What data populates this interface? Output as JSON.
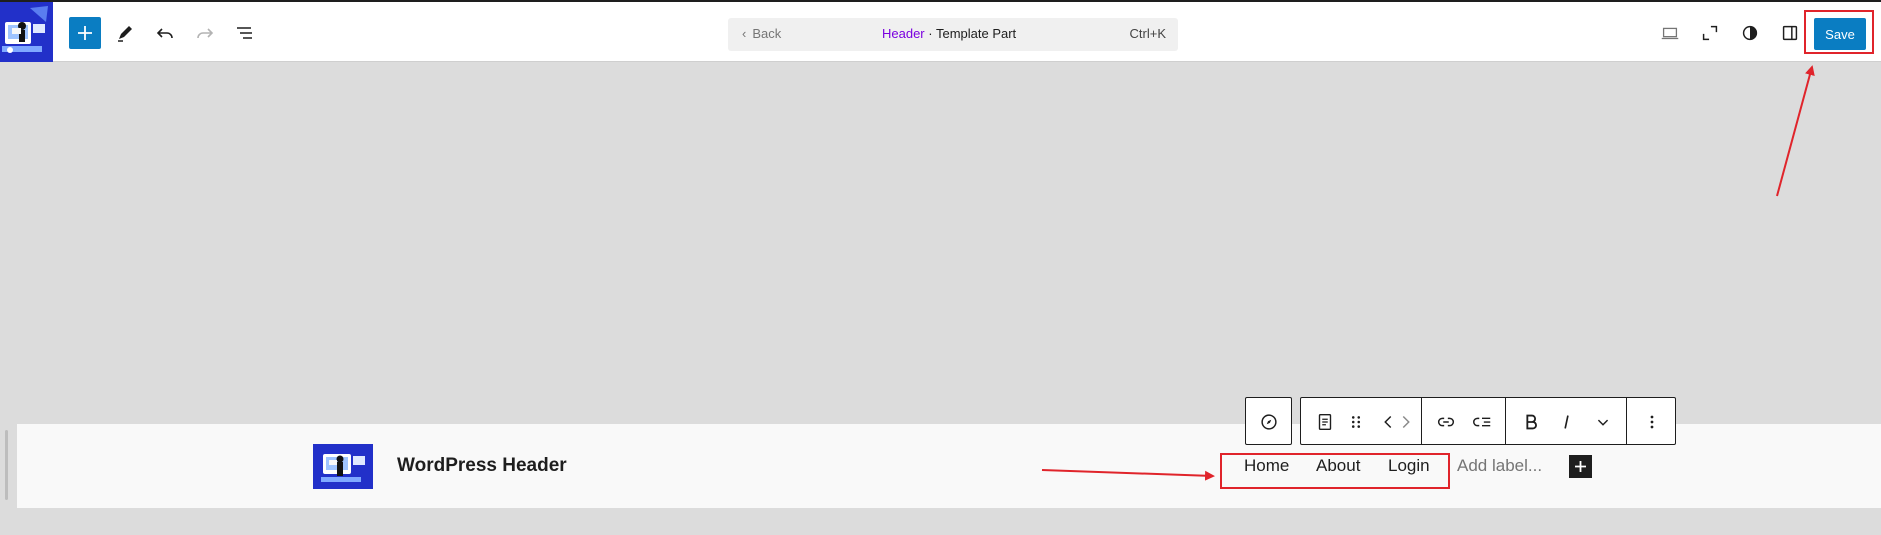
{
  "topbar": {
    "command": {
      "back_label": "Back",
      "entity_name": "Header",
      "separator": " · ",
      "entity_type": "Template Part",
      "shortcut": "Ctrl+K"
    },
    "save_label": "Save"
  },
  "header": {
    "site_title": "WordPress Header",
    "nav_items": [
      "Home",
      "About",
      "Login"
    ],
    "add_label_placeholder": "Add label..."
  },
  "colors": {
    "accent": "#0a7dc2",
    "logo_bg": "#2230c9",
    "annotation": "#e0242b",
    "breadcrumb_accent": "#7a00df"
  }
}
